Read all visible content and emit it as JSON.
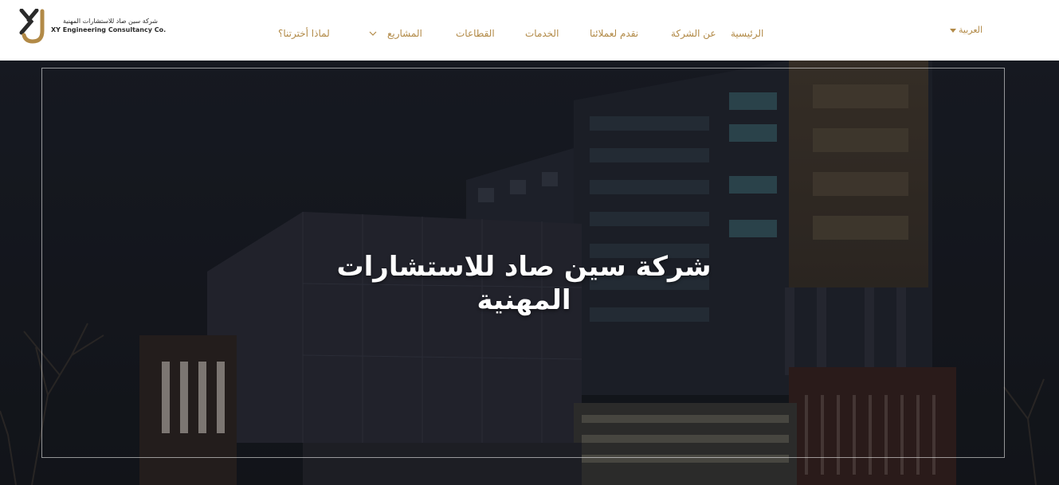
{
  "brand": {
    "name_ar": "شركة سين صاد للاستشارات المهنية",
    "name_en": "XY Engineering Consultancy Co.",
    "gold": "#b28a47"
  },
  "nav": {
    "home": "الرئيسية",
    "about": "عن الشركة",
    "offer": "نقدم لعملائنا",
    "services": "الخدمات",
    "sectors": "القطاعات",
    "projects": "المشاريع",
    "why_us": "لماذا أخترتنا؟",
    "projects_chevron_icon": "chevron-down-icon"
  },
  "language": {
    "current": "العربية",
    "caret_icon": "caret-down-icon"
  },
  "hero": {
    "title": "شركة سين صاد للاستشارات المهنية"
  }
}
